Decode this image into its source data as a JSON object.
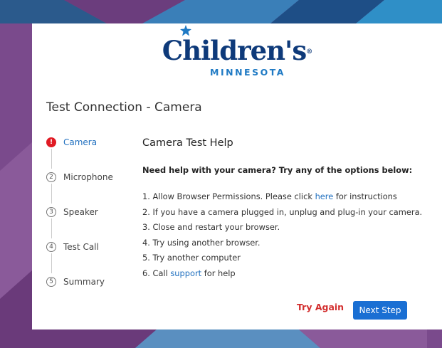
{
  "brand": {
    "name": "Children's",
    "registered_mark": "®",
    "subtitle": "MINNESOTA"
  },
  "page_title": "Test Connection - Camera",
  "steps": [
    {
      "marker": "!",
      "label": "Camera",
      "active": true
    },
    {
      "marker": "2",
      "label": "Microphone",
      "active": false
    },
    {
      "marker": "3",
      "label": "Speaker",
      "active": false
    },
    {
      "marker": "4",
      "label": "Test Call",
      "active": false
    },
    {
      "marker": "5",
      "label": "Summary",
      "active": false
    }
  ],
  "help": {
    "title": "Camera Test Help",
    "lead": "Need help with your camera? Try any of the options below:",
    "items": [
      {
        "before": "1. Allow Browser Permissions. Please click ",
        "link": "here",
        "after": " for instructions"
      },
      {
        "before": "2. If you have a camera plugged in, unplug and plug-in your camera.",
        "link": "",
        "after": ""
      },
      {
        "before": "3. Close and restart your browser.",
        "link": "",
        "after": ""
      },
      {
        "before": "4. Try using another browser.",
        "link": "",
        "after": ""
      },
      {
        "before": "5. Try another computer",
        "link": "",
        "after": ""
      },
      {
        "before": "6. Call ",
        "link": "support",
        "after": " for help"
      }
    ]
  },
  "actions": {
    "try_again": "Try Again",
    "next_step": "Next Step"
  },
  "colors": {
    "brand_navy": "#0e3a7a",
    "brand_blue": "#1f7ac4",
    "error_red": "#e01b24",
    "primary_button": "#1a6fd3",
    "link": "#1f6fbf",
    "background_purple": "#7a4a8c"
  },
  "icons": {
    "error_step": "exclamation-circle-icon",
    "logo_star": "star-icon"
  }
}
